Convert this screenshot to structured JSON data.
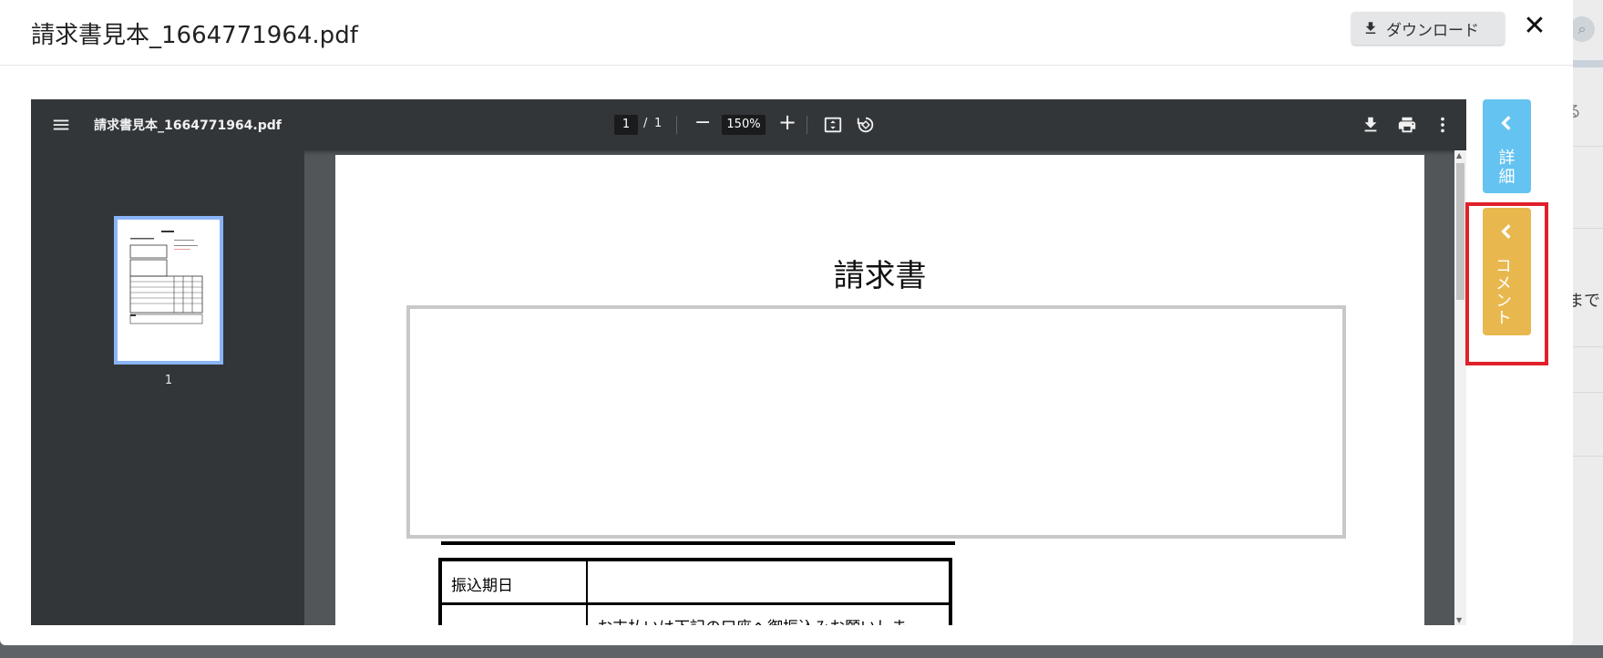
{
  "modal": {
    "title": "請求書見本_1664771964.pdf",
    "download_label": "ダウンロード",
    "close_label": "✕"
  },
  "viewer": {
    "filename": "請求書見本_1664771964.pdf",
    "page_current": "1",
    "page_separator": "/",
    "page_total": "1",
    "zoom": "150%",
    "thumbnail_page_number": "1"
  },
  "document": {
    "title": "請求書",
    "table_row1_label": "振込期日",
    "table_row2_text": "お支払いは下記の口座へ御振込みお願いしま"
  },
  "side_tabs": {
    "detail_label_1": "詳",
    "detail_label_2": "細",
    "comment_label": "コメント"
  },
  "background": {
    "partial_text_1": "る",
    "partial_text_2": "まで"
  },
  "colors": {
    "detail_tab": "#64c3f0",
    "comment_tab": "#e8b84f",
    "highlight_border": "#e0202a",
    "toolbar": "#323639"
  }
}
